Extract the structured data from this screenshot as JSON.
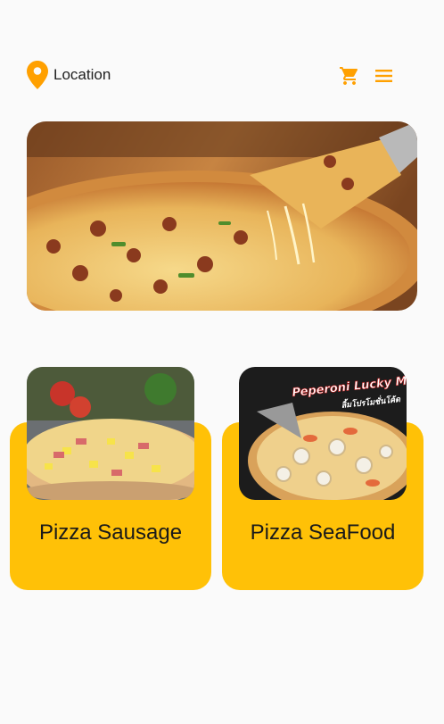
{
  "header": {
    "location_label": "Location",
    "location_icon": "location-pin-icon",
    "cart_icon": "shopping-cart-icon",
    "menu_icon": "hamburger-menu-icon"
  },
  "hero": {
    "image": "pizza-hero-image"
  },
  "categories": [
    {
      "title": "Pizza Sausage",
      "image": "hawaiian-pizza-image"
    },
    {
      "title": "Pizza SeaFood",
      "image": "seafood-pizza-image",
      "promo_text": "Peperoni Lucky Month",
      "promo_subtext": "ลิ้มโปรโมชั่นโค้ด"
    }
  ],
  "colors": {
    "accent": "#ffa000",
    "card": "#ffc107",
    "background": "#fafafa",
    "text": "#212121"
  }
}
